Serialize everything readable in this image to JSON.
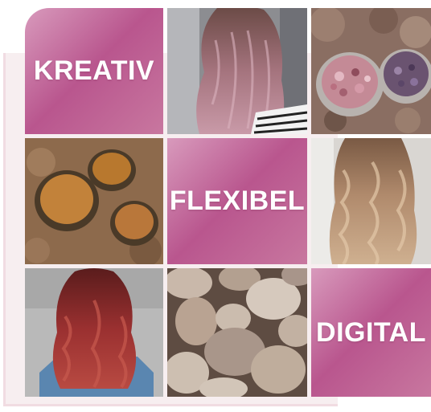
{
  "tiles": {
    "kreativ": "KREATIV",
    "flexibel": "FLEXIBEL",
    "digital": "DIGITAL"
  },
  "images": {
    "top_middle": "hair-pink-waves",
    "top_right": "dried-rose-petals-bowls",
    "middle_left": "henna-powder-bowls",
    "middle_right": "hair-blonde-waves",
    "bottom_left": "hair-red-waves",
    "bottom_middle": "river-stones"
  },
  "colors": {
    "tile_gradient_start": "#d89abc",
    "tile_gradient_mid": "#b9568e",
    "tile_gradient_end": "#c8779f",
    "frame": "#f1dce2"
  }
}
